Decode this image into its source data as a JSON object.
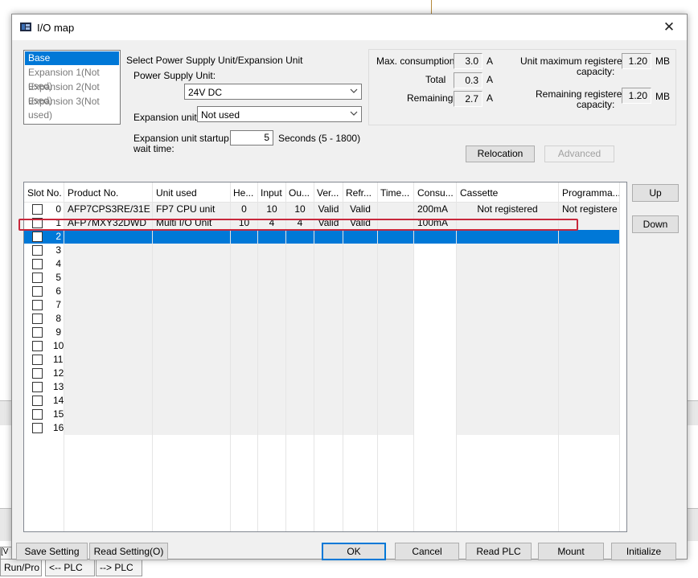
{
  "background": {
    "tabs": [
      "Run/Pro",
      "<-- PLC",
      "--> PLC"
    ],
    "left_marker": "[V"
  },
  "dialog": {
    "title": "I/O map",
    "close": "✕",
    "unit_list": [
      {
        "label": "Base",
        "selected": true
      },
      {
        "label": "Expansion 1(Not used)",
        "selected": false
      },
      {
        "label": "Expansion 2(Not used)",
        "selected": false
      },
      {
        "label": "Expansion 3(Not used)",
        "selected": false
      }
    ],
    "select_heading": "Select Power Supply Unit/Expansion Unit",
    "power_supply_label": "Power Supply Unit:",
    "power_supply_value": "24V DC",
    "expansion_unit_label": "Expansion unit:",
    "expansion_unit_value": "Not used",
    "startup_label_1": "Expansion unit startup",
    "startup_label_2": "wait time:",
    "startup_value": "5",
    "startup_range": "Seconds (5 - 1800)",
    "consumption": {
      "max_label": "Max. consumption",
      "max_value": "3.0",
      "max_unit": "A",
      "total_label": "Total",
      "total_value": "0.3",
      "total_unit": "A",
      "remaining_label": "Remaining",
      "remaining_value": "2.7",
      "remaining_unit": "A"
    },
    "capacity": {
      "max_label_1": "Unit maximum registered",
      "max_label_2": "capacity:",
      "max_value": "1.20",
      "max_unit": "MB",
      "remaining_label_1": "Remaining registered",
      "remaining_label_2": "capacity:",
      "remaining_value": "1.20",
      "remaining_unit": "MB"
    },
    "relocation_label": "Relocation",
    "advanced_label": "Advanced",
    "up_label": "Up",
    "down_label": "Down",
    "columns": [
      "Slot No.",
      "Product No.",
      "Unit used",
      "He...",
      "Input",
      "Ou...",
      "Ver...",
      "Refr...",
      "Time...",
      "Consu...",
      "Cassette",
      "Programma..."
    ],
    "rows": [
      {
        "slot": "0",
        "checked": false,
        "product": "AFP7CPS3RE/31E",
        "unit": "FP7 CPU unit",
        "head": "0",
        "input": "10",
        "output": "10",
        "verify": "Valid",
        "refresh": "Valid",
        "time": "",
        "consumption": "200mA",
        "cassette": "Not registered",
        "program": "Not registere"
      },
      {
        "slot": "1",
        "checked": false,
        "product": "AFP7MXY32DWD",
        "unit": "Multi I/O Unit",
        "head": "10",
        "input": "4",
        "output": "4",
        "verify": "Valid",
        "refresh": "Valid",
        "time": "",
        "consumption": "100mA",
        "cassette": "",
        "program": ""
      },
      {
        "slot": "2",
        "checked": true,
        "selected": true
      },
      {
        "slot": "3",
        "checked": false
      },
      {
        "slot": "4",
        "checked": false
      },
      {
        "slot": "5",
        "checked": false
      },
      {
        "slot": "6",
        "checked": false
      },
      {
        "slot": "7",
        "checked": false
      },
      {
        "slot": "8",
        "checked": false
      },
      {
        "slot": "9",
        "checked": false
      },
      {
        "slot": "10",
        "checked": false
      },
      {
        "slot": "11",
        "checked": false
      },
      {
        "slot": "12",
        "checked": false
      },
      {
        "slot": "13",
        "checked": false
      },
      {
        "slot": "14",
        "checked": false
      },
      {
        "slot": "15",
        "checked": false
      },
      {
        "slot": "16",
        "checked": false
      }
    ],
    "footer_buttons": {
      "save_setting": "Save Setting",
      "read_setting": "Read Setting(O)",
      "ok": "OK",
      "cancel": "Cancel",
      "read_plc": "Read PLC",
      "mount": "Mount",
      "initialize": "Initialize"
    },
    "colors": {
      "selection": "#0078d7",
      "highlight_box": "#c8283c",
      "disabled_fill": "#f0f0f0"
    }
  }
}
